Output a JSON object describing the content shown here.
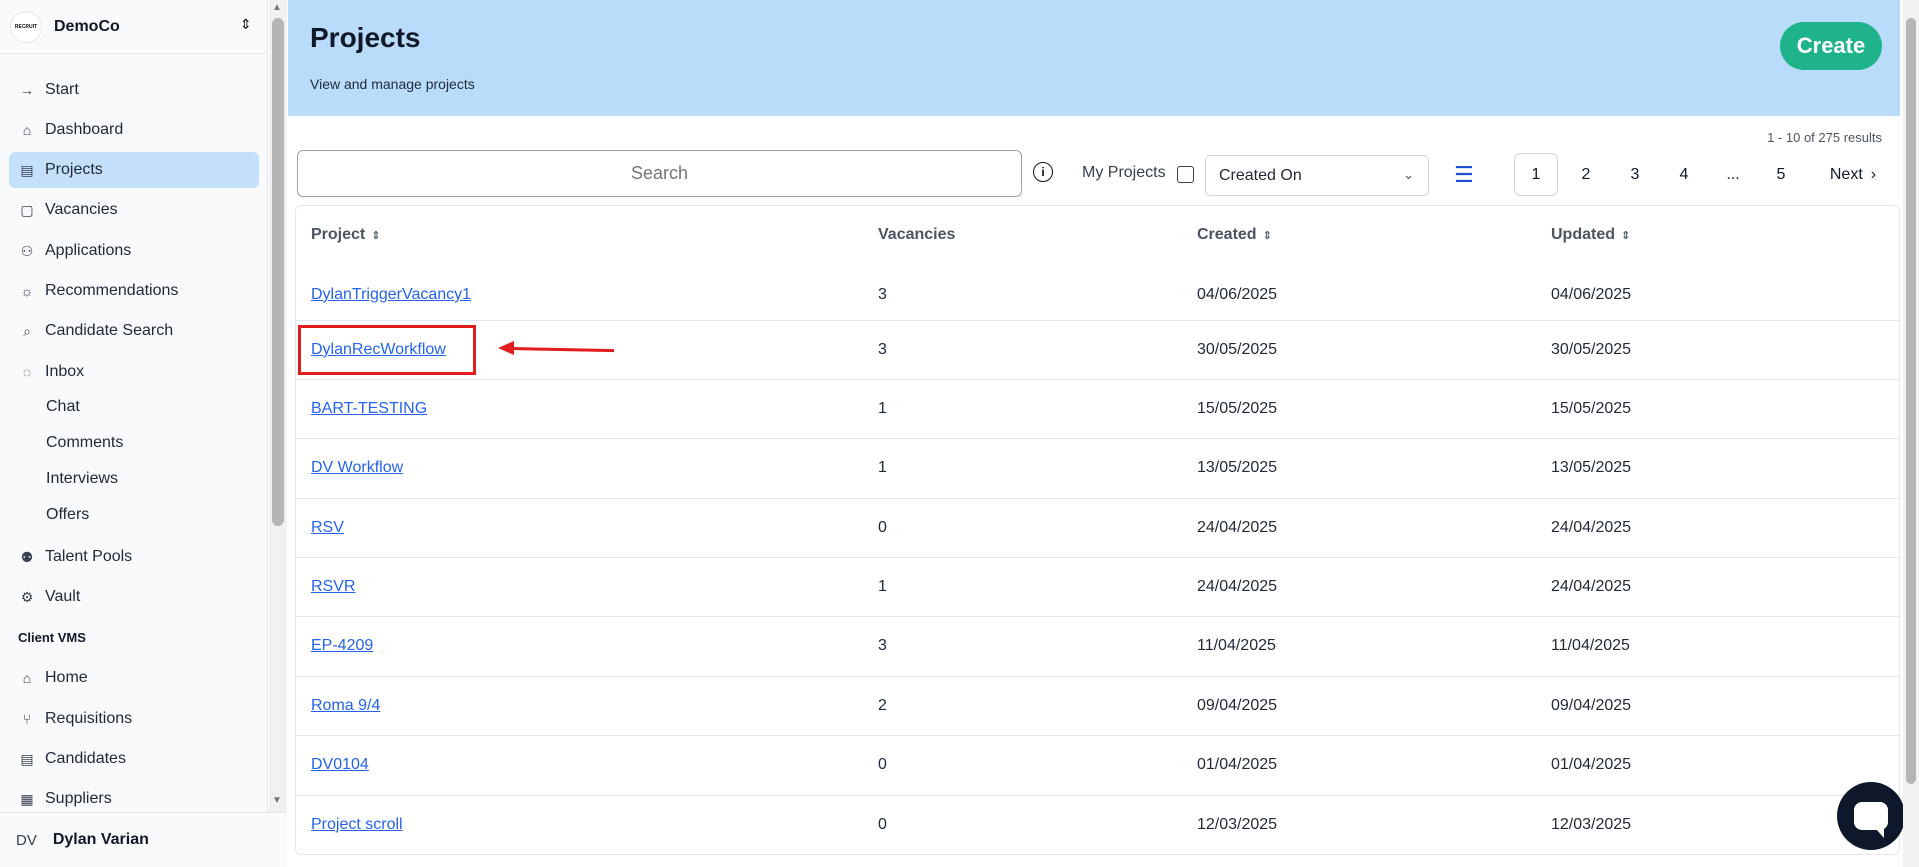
{
  "org": {
    "name": "DemoCo",
    "logo_text": "RECRUIT"
  },
  "sidebar": {
    "items": [
      {
        "label": "Start",
        "icon": "arrow-right-icon"
      },
      {
        "label": "Dashboard",
        "icon": "home-icon"
      },
      {
        "label": "Projects",
        "icon": "inbox-stack-icon",
        "active": true
      },
      {
        "label": "Vacancies",
        "icon": "clipboard-icon"
      },
      {
        "label": "Applications",
        "icon": "users-icon"
      },
      {
        "label": "Recommendations",
        "icon": "lightbulb-icon"
      },
      {
        "label": "Candidate Search",
        "icon": "search-icon"
      },
      {
        "label": "Inbox",
        "icon": "chat-bubble-icon"
      }
    ],
    "inbox_sub": [
      "Chat",
      "Comments",
      "Interviews",
      "Offers"
    ],
    "items2": [
      {
        "label": "Talent Pools",
        "icon": "group-icon"
      },
      {
        "label": "Vault",
        "icon": "gear-icon"
      }
    ],
    "section": "Client VMS",
    "items3": [
      {
        "label": "Home",
        "icon": "home-icon"
      },
      {
        "label": "Requisitions",
        "icon": "branch-icon"
      },
      {
        "label": "Candidates",
        "icon": "inbox-stack-icon"
      },
      {
        "label": "Suppliers",
        "icon": "building-icon"
      }
    ],
    "user": {
      "initials": "DV",
      "name": "Dylan Varian"
    }
  },
  "header": {
    "title": "Projects",
    "subtitle": "View and manage projects",
    "create_label": "Create"
  },
  "results_text": "1 - 10 of 275 results",
  "toolbar": {
    "search_placeholder": "Search",
    "my_projects_label": "My Projects",
    "sort_value": "Created On"
  },
  "pagination": {
    "pages": [
      "1",
      "2",
      "3",
      "4",
      "...",
      "5"
    ],
    "current": "1",
    "next_label": "Next"
  },
  "table": {
    "headers": {
      "project": "Project",
      "vacancies": "Vacancies",
      "created": "Created",
      "updated": "Updated"
    },
    "rows": [
      {
        "project": "DylanTriggerVacancy1",
        "vacancies": "3",
        "created": "04/06/2025",
        "updated": "04/06/2025"
      },
      {
        "project": "DylanRecWorkflow",
        "vacancies": "3",
        "created": "30/05/2025",
        "updated": "30/05/2025"
      },
      {
        "project": "BART-TESTING",
        "vacancies": "1",
        "created": "15/05/2025",
        "updated": "15/05/2025"
      },
      {
        "project": "DV Workflow",
        "vacancies": "1",
        "created": "13/05/2025",
        "updated": "13/05/2025"
      },
      {
        "project": "RSV",
        "vacancies": "0",
        "created": "24/04/2025",
        "updated": "24/04/2025"
      },
      {
        "project": "RSVR",
        "vacancies": "1",
        "created": "24/04/2025",
        "updated": "24/04/2025"
      },
      {
        "project": "EP-4209",
        "vacancies": "3",
        "created": "11/04/2025",
        "updated": "11/04/2025"
      },
      {
        "project": "Roma 9/4",
        "vacancies": "2",
        "created": "09/04/2025",
        "updated": "09/04/2025"
      },
      {
        "project": "DV0104",
        "vacancies": "0",
        "created": "01/04/2025",
        "updated": "01/04/2025"
      },
      {
        "project": "Project scroll",
        "vacancies": "0",
        "created": "12/03/2025",
        "updated": "12/03/2025"
      }
    ]
  },
  "colors": {
    "accent": "#1eb38a",
    "hero": "#b9dcfa",
    "active_nav": "#c5e0fb",
    "link": "#2563eb",
    "annotation": "#e11d1d"
  }
}
